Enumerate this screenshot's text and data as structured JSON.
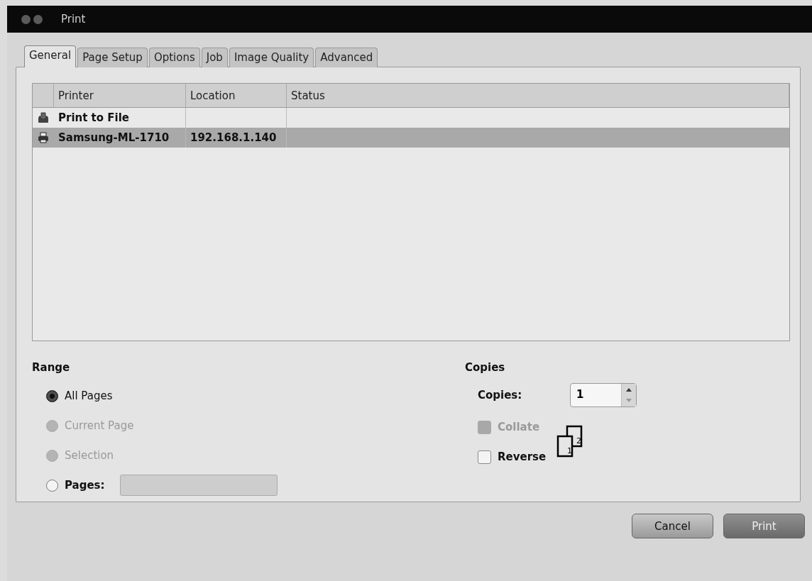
{
  "window": {
    "title": "Print"
  },
  "tabs": [
    {
      "label": "General",
      "selected": true
    },
    {
      "label": "Page Setup",
      "selected": false
    },
    {
      "label": "Options",
      "selected": false
    },
    {
      "label": "Job",
      "selected": false
    },
    {
      "label": "Image Quality",
      "selected": false
    },
    {
      "label": "Advanced",
      "selected": false
    }
  ],
  "printers": {
    "columns": [
      "Printer",
      "Location",
      "Status"
    ],
    "rows": [
      {
        "kind": "file",
        "name": "Print to File",
        "location": "",
        "status": "",
        "selected": false
      },
      {
        "kind": "printer",
        "name": "Samsung-ML-1710",
        "location": "192.168.1.140",
        "status": "",
        "selected": true
      }
    ]
  },
  "range": {
    "heading": "Range",
    "options": [
      {
        "label": "All Pages",
        "selected": true,
        "disabled": false
      },
      {
        "label": "Current Page",
        "selected": false,
        "disabled": true
      },
      {
        "label": "Selection",
        "selected": false,
        "disabled": true
      },
      {
        "label": "Pages:",
        "selected": false,
        "disabled": false,
        "has_field": true
      }
    ]
  },
  "copies": {
    "heading": "Copies",
    "label": "Copies:",
    "value": "1",
    "checks": [
      {
        "label": "Collate",
        "checked": false,
        "disabled": true
      },
      {
        "label": "Reverse",
        "checked": false,
        "disabled": false
      }
    ],
    "collate_pages": [
      "1",
      "2"
    ]
  },
  "buttons": [
    {
      "label": "Cancel",
      "default": false
    },
    {
      "label": "Print",
      "default": true
    }
  ]
}
